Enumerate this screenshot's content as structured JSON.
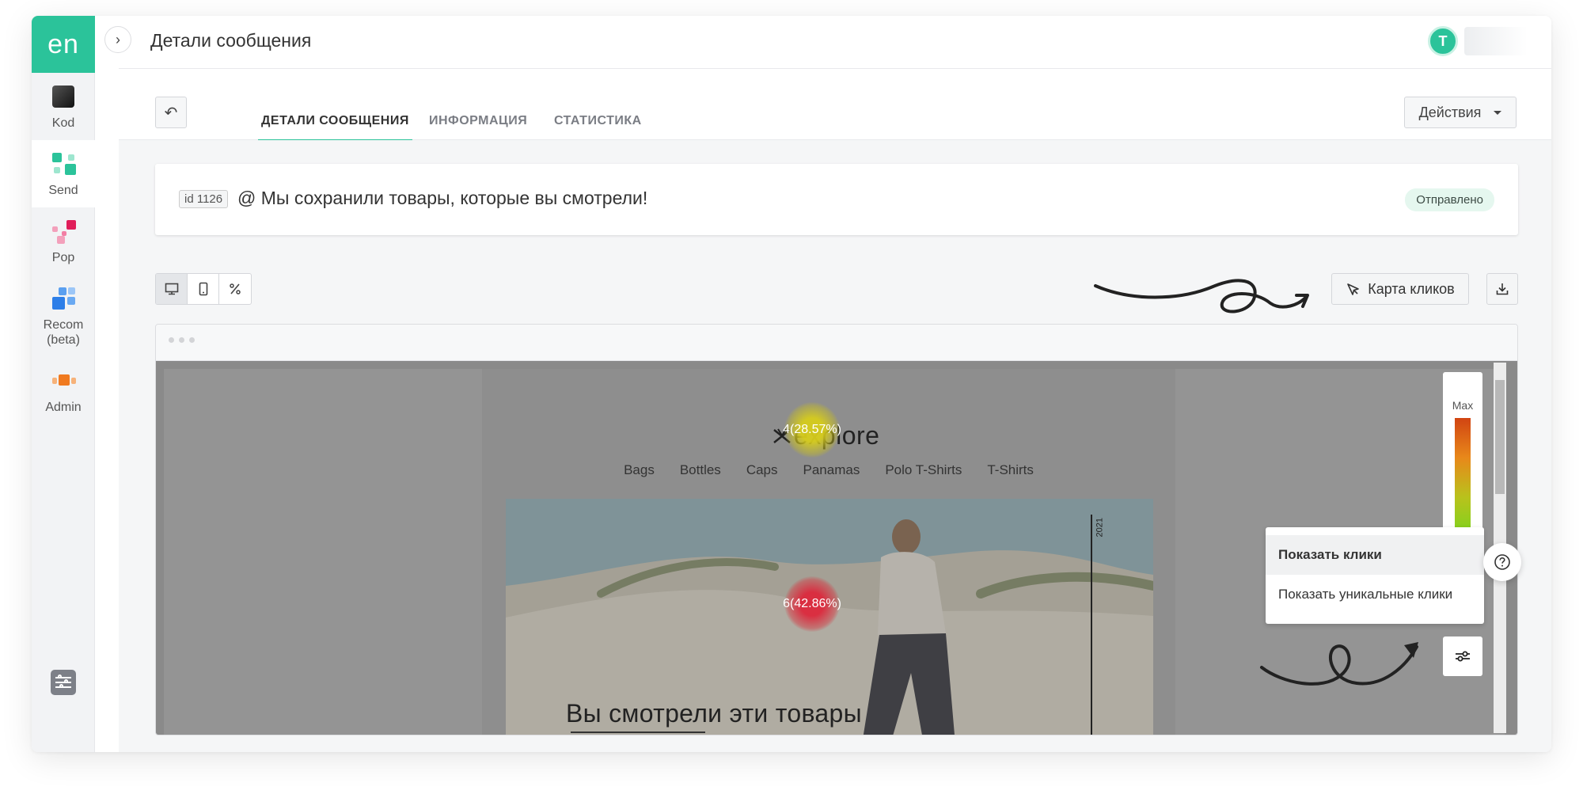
{
  "brand": {
    "logo_text": "en",
    "color": "#2bc39a"
  },
  "sidebar": {
    "items": [
      {
        "label": "Kod",
        "icon": "kod-icon"
      },
      {
        "label": "Send",
        "icon": "send-icon",
        "active": true
      },
      {
        "label": "Pop",
        "icon": "pop-icon"
      },
      {
        "label": "Recom (beta)",
        "icon": "recom-icon"
      },
      {
        "label": "Admin",
        "icon": "admin-icon"
      }
    ],
    "settings_icon": "settings-sliders-icon"
  },
  "header": {
    "title": "Детали сообщения",
    "avatar_initial": "T"
  },
  "tabs": {
    "items": [
      {
        "label": "ДЕТАЛИ СООБЩЕНИЯ",
        "active": true
      },
      {
        "label": "ИНФОРМАЦИЯ",
        "active": false
      },
      {
        "label": "СТАТИСТИКА",
        "active": false
      }
    ],
    "actions_label": "Действия"
  },
  "message": {
    "id_label": "id 1126",
    "subject": "@ Мы сохранили товары, которые вы смотрели!",
    "status": "Отправлено"
  },
  "toolbar": {
    "view_modes": [
      "desktop-icon",
      "mobile-icon",
      "percent-icon"
    ],
    "active_view": "desktop-icon",
    "click_map_label": "Карта кликов"
  },
  "email": {
    "logo_text": "explore",
    "nav": [
      "Bags",
      "Bottles",
      "Caps",
      "Panamas",
      "Polo T-Shirts",
      "T-Shirts"
    ],
    "hero_title": "Вы смотрели эти товары",
    "hero_year": "2021"
  },
  "heatmap": {
    "spots": [
      {
        "label": "4(28.57%)",
        "share": 0.2857
      },
      {
        "label": "6(42.86%)",
        "share": 0.4286
      }
    ],
    "legend_label": "Max"
  },
  "click_menu": {
    "items": [
      {
        "label": "Показать клики",
        "active": true
      },
      {
        "label": "Показать уникальные клики",
        "active": false
      }
    ]
  }
}
